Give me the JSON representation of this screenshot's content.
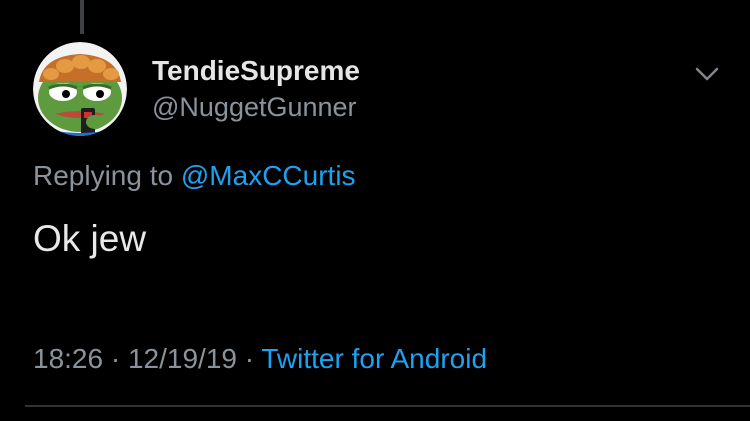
{
  "tweet": {
    "display_name": "TendieSupreme",
    "handle": "@NuggetGunner",
    "replying_prefix": "Replying to",
    "replying_to": "@MaxCCurtis",
    "text": "Ok jew",
    "time": "18:26",
    "date": "12/19/19",
    "separator": "·",
    "source": "Twitter for Android",
    "avatar_icon": "pepe-avatar-icon",
    "menu_icon": "chevron-down-icon"
  },
  "colors": {
    "background": "#000000",
    "text_primary": "#e6e6e6",
    "text_secondary": "#8a939b",
    "link": "#1da1f2",
    "divider": "#2f3336"
  }
}
